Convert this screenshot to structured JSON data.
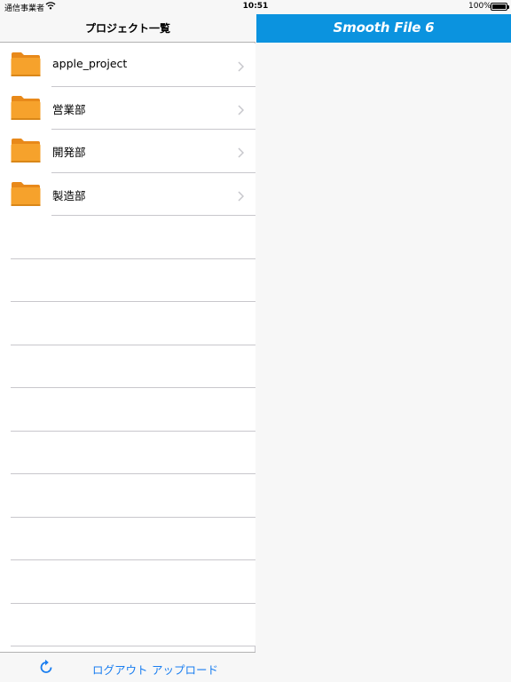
{
  "status_bar": {
    "carrier": "通信事業者",
    "time": "10:51",
    "battery": "100%"
  },
  "left_pane": {
    "title": "プロジェクト一覧",
    "folders": [
      {
        "label": "apple_project",
        "icon": "folder-icon"
      },
      {
        "label": "営業部",
        "icon": "folder-icon"
      },
      {
        "label": "開発部",
        "icon": "folder-icon"
      },
      {
        "label": "製造部",
        "icon": "folder-icon"
      }
    ],
    "toolbar": {
      "refresh_icon": "refresh-icon",
      "logout_label": "ログアウト",
      "upload_label": "アップロード"
    }
  },
  "right_pane": {
    "brand": "Smooth File 6",
    "brand_color": "#0b93df"
  },
  "colors": {
    "folder_orange": "#f39c1f",
    "link_blue": "#1a7ef0"
  }
}
